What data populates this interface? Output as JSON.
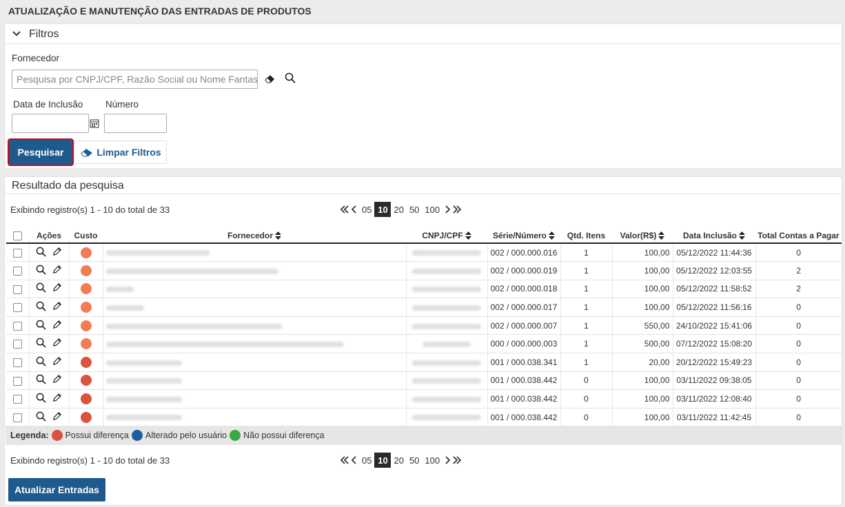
{
  "page": {
    "title": "ATUALIZAÇÃO E MANUTENÇÃO DAS ENTRADAS DE PRODUTOS"
  },
  "colors": {
    "primary": "#1f5a8d",
    "highlight_border": "#d0021b",
    "dot_orange": "#f47c55",
    "dot_red": "#d9533f",
    "dot_blue": "#1a5fa0",
    "dot_green": "#3aa845"
  },
  "filters": {
    "header": "Filtros",
    "supplier_label": "Fornecedor",
    "supplier_placeholder": "Pesquisa por CNPJ/CPF, Razão Social ou Nome Fantasia",
    "date_label": "Data de Inclusão",
    "date_value": "",
    "number_label": "Número",
    "number_value": "",
    "search_button": "Pesquisar",
    "clear_button": "Limpar Filtros",
    "icons": [
      "chevron-down-icon",
      "eraser-icon",
      "search-icon",
      "calendar-icon"
    ]
  },
  "results": {
    "header": "Resultado da pesquisa",
    "info_top": "Exibindo registro(s) 1 - 10 do total de 33",
    "info_bottom": "Exibindo registro(s) 1 - 10 do total de 33",
    "page_sizes": [
      "05",
      "10",
      "20",
      "50",
      "100"
    ],
    "active_page_size": "10",
    "columns": {
      "actions": "Ações",
      "cost": "Custo",
      "supplier": "Fornecedor",
      "cnpj": "CNPJ/CPF",
      "serie": "Série/Número",
      "qty": "Qtd. Itens",
      "value": "Valor(R$)",
      "date": "Data Inclusão",
      "total": "Total Contas a Pagar"
    },
    "rows": [
      {
        "cost": "orange",
        "serie": "002 / 000.000.016",
        "qty": "1",
        "value": "100,00",
        "date": "05/12/2022 11:44:36",
        "total": "0"
      },
      {
        "cost": "orange",
        "serie": "002 / 000.000.019",
        "qty": "1",
        "value": "100,00",
        "date": "05/12/2022 12:03:55",
        "total": "2"
      },
      {
        "cost": "orange",
        "serie": "002 / 000.000.018",
        "qty": "1",
        "value": "100,00",
        "date": "05/12/2022 11:58:52",
        "total": "2"
      },
      {
        "cost": "orange",
        "serie": "002 / 000.000.017",
        "qty": "1",
        "value": "100,00",
        "date": "05/12/2022 11:56:16",
        "total": "0"
      },
      {
        "cost": "orange",
        "serie": "002 / 000.000.007",
        "qty": "1",
        "value": "550,00",
        "date": "24/10/2022 15:41:06",
        "total": "0"
      },
      {
        "cost": "orange",
        "serie": "000 / 000.000.003",
        "qty": "1",
        "value": "500,00",
        "date": "07/12/2022 15:08:20",
        "total": "0"
      },
      {
        "cost": "red",
        "serie": "001 / 000.038.341",
        "qty": "1",
        "value": "20,00",
        "date": "20/12/2022 15:49:23",
        "total": "0"
      },
      {
        "cost": "red",
        "serie": "001 / 000.038.442",
        "qty": "0",
        "value": "100,00",
        "date": "03/11/2022 09:38:05",
        "total": "0"
      },
      {
        "cost": "red",
        "serie": "001 / 000.038.442",
        "qty": "0",
        "value": "100,00",
        "date": "03/11/2022 12:08:40",
        "total": "0"
      },
      {
        "cost": "red",
        "serie": "001 / 000.038.442",
        "qty": "0",
        "value": "100,00",
        "date": "03/11/2022 11:42:45",
        "total": "0"
      }
    ],
    "legend": {
      "label": "Legenda:",
      "items": [
        {
          "text": "Possui diferença",
          "color": "#d9533f"
        },
        {
          "text": "Alterado pelo usuário",
          "color": "#1a5fa0"
        },
        {
          "text": "Não possui diferença",
          "color": "#3aa845"
        }
      ]
    },
    "update_button": "Atualizar Entradas"
  }
}
